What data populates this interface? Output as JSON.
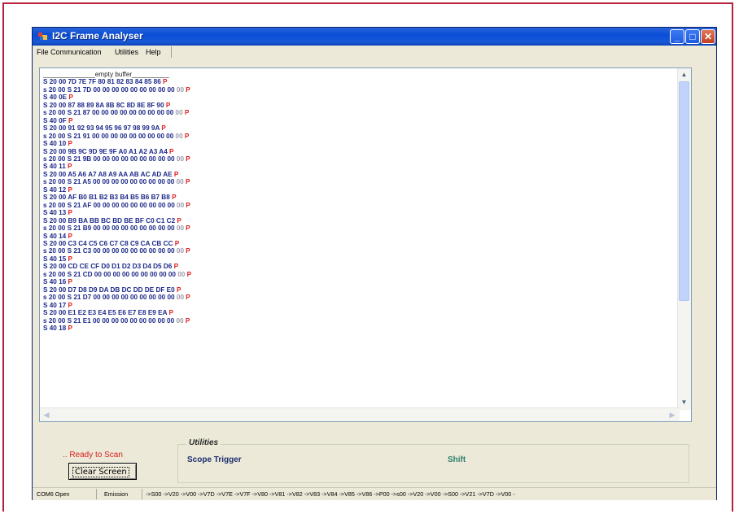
{
  "window": {
    "title": "I2C Frame Analyser"
  },
  "menu": [
    "File",
    "Communication",
    "Utilities",
    "Help"
  ],
  "header_text": "______________empty buffer__________",
  "log_lines": [
    {
      "text": "S 20 00 7D 7E 7F 80 81 82 83 84 85 86 ",
      "p": "P",
      "dim": ""
    },
    {
      "text": "s 20 00 S 21 7D 00 00 00 00 00 00 00 00 00 ",
      "p": "P",
      "dim": "00 "
    },
    {
      "text": "S 40 0E ",
      "p": "P",
      "dim": ""
    },
    {
      "text": "S 20 00 87 88 89 8A 8B 8C 8D 8E 8F 90 ",
      "p": "P",
      "dim": ""
    },
    {
      "text": "s 20 00 S 21 87 00 00 00 00 00 00 00 00 00 ",
      "p": "P",
      "dim": "00 "
    },
    {
      "text": "S 40 0F ",
      "p": "P",
      "dim": ""
    },
    {
      "text": "S 20 00 91 92 93 94 95 96 97 98 99 9A ",
      "p": "P",
      "dim": ""
    },
    {
      "text": "s 20 00 S 21 91 00 00 00 00 00 00 00 00 00 ",
      "p": "P",
      "dim": "00 "
    },
    {
      "text": "S 40 10 ",
      "p": "P",
      "dim": ""
    },
    {
      "text": "S 20 00 9B 9C 9D 9E 9F A0 A1 A2 A3 A4 ",
      "p": "P",
      "dim": ""
    },
    {
      "text": "s 20 00 S 21 9B 00 00 00 00 00 00 00 00 00 ",
      "p": "P",
      "dim": "00 "
    },
    {
      "text": "S 40 11 ",
      "p": "P",
      "dim": ""
    },
    {
      "text": "S 20 00 A5 A6 A7 A8 A9 AA AB AC AD AE ",
      "p": "P",
      "dim": ""
    },
    {
      "text": "s 20 00 S 21 A5 00 00 00 00 00 00 00 00 00 ",
      "p": "P",
      "dim": "00 "
    },
    {
      "text": "S 40 12 ",
      "p": "P",
      "dim": ""
    },
    {
      "text": "S 20 00 AF B0 B1 B2 B3 B4 B5 B6 B7 B8 ",
      "p": "P",
      "dim": ""
    },
    {
      "text": "s 20 00 S 21 AF 00 00 00 00 00 00 00 00 00 ",
      "p": "P",
      "dim": "00 "
    },
    {
      "text": "S 40 13 ",
      "p": "P",
      "dim": ""
    },
    {
      "text": "S 20 00 B9 BA BB BC BD BE BF C0 C1 C2 ",
      "p": "P",
      "dim": ""
    },
    {
      "text": "s 20 00 S 21 B9 00 00 00 00 00 00 00 00 00 ",
      "p": "P",
      "dim": "00 "
    },
    {
      "text": "S 40 14 ",
      "p": "P",
      "dim": ""
    },
    {
      "text": "S 20 00 C3 C4 C5 C6 C7 C8 C9 CA CB CC ",
      "p": "P",
      "dim": ""
    },
    {
      "text": "s 20 00 S 21 C3 00 00 00 00 00 00 00 00 00 ",
      "p": "P",
      "dim": "00 "
    },
    {
      "text": "S 40 15 ",
      "p": "P",
      "dim": ""
    },
    {
      "text": "S 20 00 CD CE CF D0 D1 D2 D3 D4 D5 D6 ",
      "p": "P",
      "dim": ""
    },
    {
      "text": "s 20 00 S 21 CD 00 00 00 00 00 00 00 00 00 ",
      "p": "P",
      "dim": "00 "
    },
    {
      "text": "S 40 16 ",
      "p": "P",
      "dim": ""
    },
    {
      "text": "S 20 00 D7 D8 D9 DA DB DC DD DE DF E0 ",
      "p": "P",
      "dim": ""
    },
    {
      "text": "s 20 00 S 21 D7 00 00 00 00 00 00 00 00 00 ",
      "p": "P",
      "dim": "00 "
    },
    {
      "text": "S 40 17 ",
      "p": "P",
      "dim": ""
    },
    {
      "text": "S 20 00 E1 E2 E3 E4 E5 E6 E7 E8 E9 EA ",
      "p": "P",
      "dim": ""
    },
    {
      "text": "s 20 00 S 21 E1 00 00 00 00 00 00 00 00 00 ",
      "p": "P",
      "dim": "00 "
    },
    {
      "text": "S 40 18 ",
      "p": "P",
      "dim": ""
    }
  ],
  "status_ready": ".. Ready to Scan",
  "clear_screen_label": "Clear Screen",
  "utilities": {
    "legend": "Utilities",
    "scope_trigger": "Scope Trigger",
    "shift": "Shift"
  },
  "statusbar": {
    "port": "COM6 Open",
    "mode": "Emission",
    "sequence": "->S00 ->V20 ->V00 ->V7D ->V7E ->V7F ->V80 ->V81 ->V82 ->V83 ->V84 ->V85 ->V86 ->P00 ->s00 ->V20 ->V00 ->S00 ->V21 ->V7D ->V00 -"
  },
  "colors": {
    "titlebar": "#0a4ed8",
    "text_blue": "#1d2a8a",
    "stop_red": "#e02020",
    "ready_red": "#d81e1e",
    "shift_teal": "#2f7f6c"
  },
  "icons": [
    "app-icon",
    "minimize-icon",
    "maximize-icon",
    "close-icon",
    "scroll-up-icon",
    "scroll-down-icon",
    "scroll-left-icon",
    "scroll-right-icon"
  ]
}
